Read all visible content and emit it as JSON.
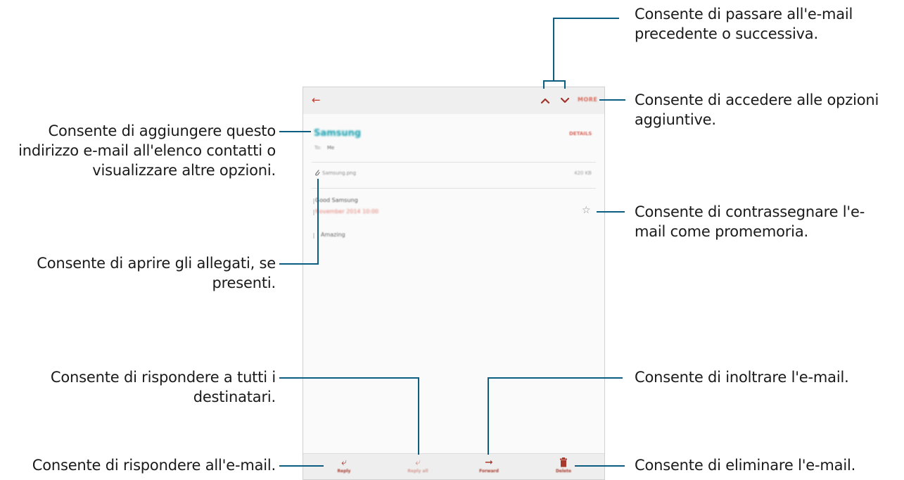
{
  "screen": {
    "back_icon": "back-arrow-icon",
    "more_label": "MORE",
    "sender": "Samsung",
    "to_label": "To:",
    "to_value": "Me",
    "details_label": "DETAILS",
    "attachment_name": "Samsung.png",
    "attachment_size": "420 KB",
    "subject": "Good Samsung",
    "date": "November 2014 10:00",
    "body": "Amazing",
    "star_icon": "star-icon",
    "bottom": {
      "reply": "Reply",
      "reply_all": "Reply all",
      "forward": "Forward",
      "delete": "Delete"
    }
  },
  "callouts": {
    "nav": "Consente di passare all'e-mail precedente o successiva.",
    "more": "Consente di accedere alle opzioni aggiuntive.",
    "sender": "Consente di aggiungere questo indirizzo e-mail all'elenco contatti o visualizzare altre opzioni.",
    "star": "Consente di contrassegnare l'e-mail come promemoria.",
    "attachment": "Consente di aprire gli allegati, se presenti.",
    "reply_all": "Consente di rispondere a tutti i destinatari.",
    "forward": "Consente di inoltrare l'e-mail.",
    "reply": "Consente di rispondere all'e-mail.",
    "delete": "Consente di eliminare l'e-mail."
  },
  "colors": {
    "accent": "#a8392c",
    "sender": "#18a0b0",
    "callout_line": "#0b5d82"
  }
}
